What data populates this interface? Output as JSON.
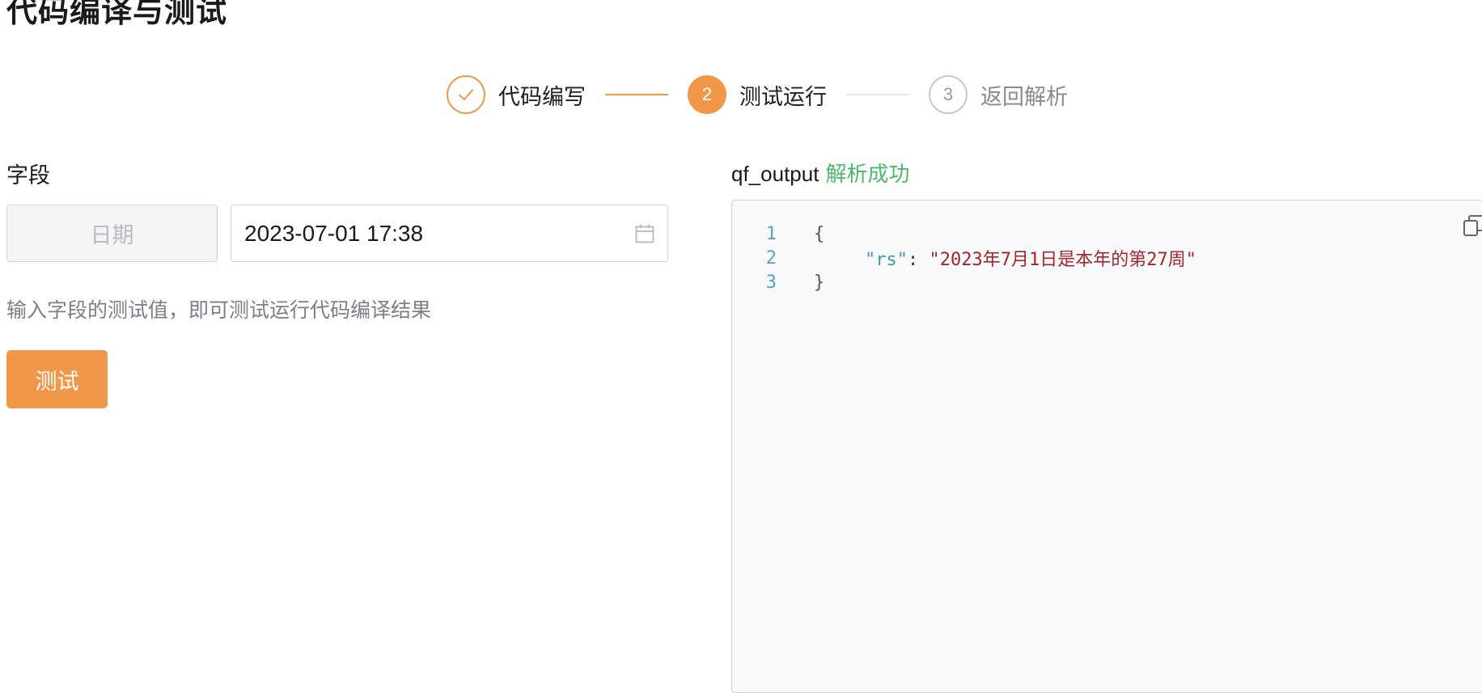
{
  "page": {
    "title": "代码编译与测试"
  },
  "steps": [
    {
      "label": "代码编写",
      "status": "done"
    },
    {
      "label": "测试运行",
      "status": "active",
      "number": "2"
    },
    {
      "label": "返回解析",
      "status": "pending",
      "number": "3"
    }
  ],
  "field": {
    "label": "字段",
    "type_label": "日期",
    "value": "2023-07-01 17:38",
    "hint": "输入字段的测试值，即可测试运行代码编译结果"
  },
  "actions": {
    "test_label": "测试"
  },
  "output": {
    "name": "qf_output",
    "status": "解析成功",
    "lines": [
      {
        "num": "1",
        "text": "{"
      },
      {
        "num": "2",
        "key": "\"rs\"",
        "sep": ": ",
        "value": "\"2023年7月1日是本年的第27周\""
      },
      {
        "num": "3",
        "text": "}"
      }
    ]
  },
  "colors": {
    "accent": "#f0974a",
    "success": "#4cb96b",
    "string": "#a3262b",
    "key": "#3b9ab0"
  },
  "icons": [
    "check-icon",
    "calendar-icon",
    "copy-icon"
  ]
}
